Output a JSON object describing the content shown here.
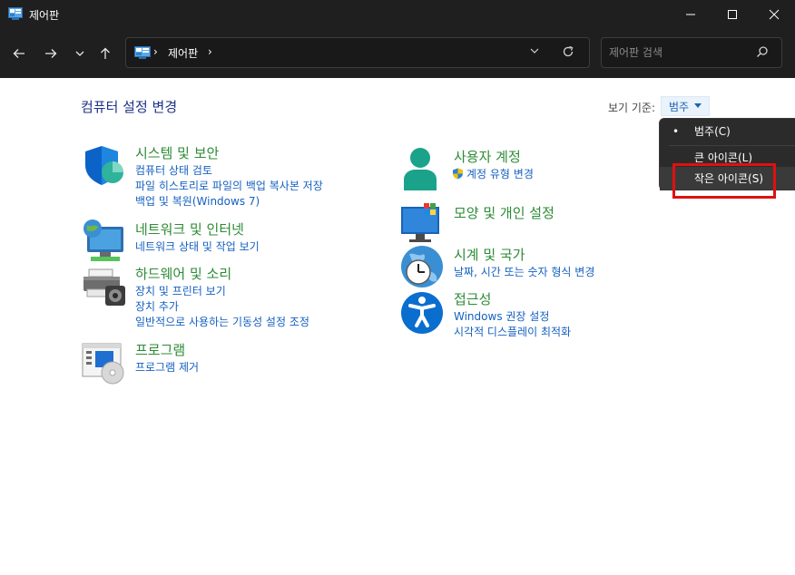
{
  "window": {
    "title": "제어판"
  },
  "address": {
    "crumb": "제어판",
    "sep": "›"
  },
  "search": {
    "placeholder": "제어판 검색"
  },
  "page": {
    "title": "컴퓨터 설정 변경"
  },
  "view": {
    "label": "보기 기준:",
    "value": "범주"
  },
  "categories": {
    "system": {
      "title": "시스템 및 보안",
      "links": [
        "컴퓨터 상태 검토",
        "파일 히스토리로 파일의 백업 복사본 저장",
        "백업 및 복원(Windows 7)"
      ]
    },
    "network": {
      "title": "네트워크 및 인터넷",
      "links": [
        "네트워크 상태 및 작업 보기"
      ]
    },
    "hardware": {
      "title": "하드웨어 및 소리",
      "links": [
        "장치 및 프린터 보기",
        "장치 추가",
        "일반적으로 사용하는 기동성 설정 조정"
      ]
    },
    "programs": {
      "title": "프로그램",
      "links": [
        "프로그램 제거"
      ]
    },
    "users": {
      "title": "사용자 계정",
      "links": [
        "계정 유형 변경"
      ]
    },
    "appearance": {
      "title": "모양 및 개인 설정",
      "links": []
    },
    "clock": {
      "title": "시계 및 국가",
      "links": [
        "날짜, 시간 또는 숫자 형식 변경"
      ]
    },
    "access": {
      "title": "접근성",
      "links": [
        "Windows 권장 설정",
        "시각적 디스플레이 최적화"
      ]
    }
  },
  "menu": {
    "bullet": "•",
    "items": [
      "범주(C)",
      "큰 아이콘(L)",
      "작은 아이콘(S)"
    ],
    "selected": "범주(C)",
    "highlighted": "작은 아이콘(S)"
  },
  "colors": {
    "accent": "#1560c0",
    "category": "#2e8b36",
    "title": "#1e3287",
    "highlight": "#e01010"
  }
}
